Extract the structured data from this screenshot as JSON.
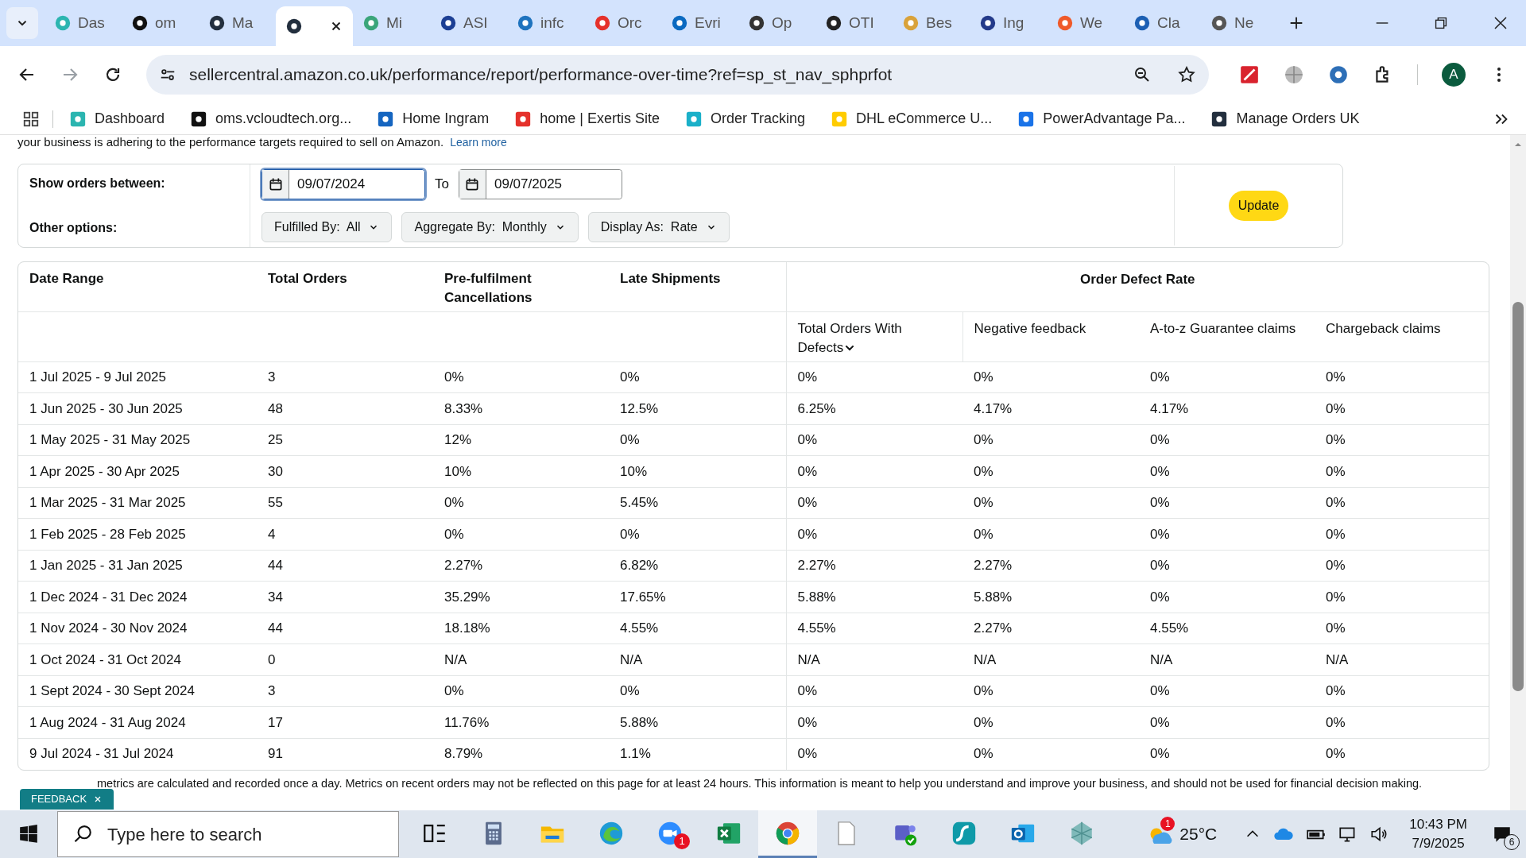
{
  "browser": {
    "tabs": [
      {
        "title": "Das",
        "selected": false
      },
      {
        "title": "om",
        "selected": false
      },
      {
        "title": "Ma",
        "selected": false
      },
      {
        "selected": true
      },
      {
        "title": "Mi",
        "selected": false
      },
      {
        "title": "ASI",
        "selected": false
      },
      {
        "title": "infc",
        "selected": false
      },
      {
        "title": "Orc",
        "selected": false
      },
      {
        "title": "Evri",
        "selected": false
      },
      {
        "title": "Op",
        "selected": false
      },
      {
        "title": "OTI",
        "selected": false
      },
      {
        "title": "Bes",
        "selected": false
      },
      {
        "title": "Ing",
        "selected": false
      },
      {
        "title": "We",
        "selected": false
      },
      {
        "title": "Cla",
        "selected": false
      },
      {
        "title": "Ne",
        "selected": false
      }
    ],
    "address": "sellercentral.amazon.co.uk/performance/report/performance-over-time?ref=sp_st_nav_sphprfot",
    "profile": "A",
    "bookmarks": [
      "Dashboard",
      "oms.vcloudtech.org...",
      "Home Ingram",
      "home | Exertis Site",
      "Order Tracking",
      "DHL eCommerce U...",
      "PowerAdvantage Pa...",
      "Manage Orders UK"
    ]
  },
  "page": {
    "intro": "your business is adhering to the performance targets required to sell on Amazon.",
    "intro_link": "Learn more",
    "filters": {
      "range_label": "Show orders between:",
      "from": "09/07/2024",
      "to_label": "To",
      "to": "09/07/2025",
      "options_label": "Other options:",
      "dropdowns": [
        {
          "label": "Fulfilled By:",
          "value": "All"
        },
        {
          "label": "Aggregate By:",
          "value": "Monthly"
        },
        {
          "label": "Display As:",
          "value": "Rate"
        }
      ],
      "update": "Update"
    },
    "table": {
      "columns": [
        "Date Range",
        "Total Orders",
        "Pre-fulfilment Cancellations",
        "Late Shipments"
      ],
      "group": "Order Defect Rate",
      "subcolumns": [
        {
          "label": "Total Orders With Defects",
          "sortable": true
        },
        {
          "label": "Negative feedback",
          "sortable": false
        },
        {
          "label": "A-to-z Guarantee claims",
          "sortable": false
        },
        {
          "label": "Chargeback claims",
          "sortable": false
        }
      ],
      "rows": [
        [
          "1 Jul 2025 - 9 Jul 2025",
          "3",
          "0%",
          "0%",
          "0%",
          "0%",
          "0%",
          "0%"
        ],
        [
          "1 Jun 2025 - 30 Jun 2025",
          "48",
          "8.33%",
          "12.5%",
          "6.25%",
          "4.17%",
          "4.17%",
          "0%"
        ],
        [
          "1 May 2025 - 31 May 2025",
          "25",
          "12%",
          "0%",
          "0%",
          "0%",
          "0%",
          "0%"
        ],
        [
          "1 Apr 2025 - 30 Apr 2025",
          "30",
          "10%",
          "10%",
          "0%",
          "0%",
          "0%",
          "0%"
        ],
        [
          "1 Mar 2025 - 31 Mar 2025",
          "55",
          "0%",
          "5.45%",
          "0%",
          "0%",
          "0%",
          "0%"
        ],
        [
          "1 Feb 2025 - 28 Feb 2025",
          "4",
          "0%",
          "0%",
          "0%",
          "0%",
          "0%",
          "0%"
        ],
        [
          "1 Jan 2025 - 31 Jan 2025",
          "44",
          "2.27%",
          "6.82%",
          "2.27%",
          "2.27%",
          "0%",
          "0%"
        ],
        [
          "1 Dec 2024 - 31 Dec 2024",
          "34",
          "35.29%",
          "17.65%",
          "5.88%",
          "5.88%",
          "0%",
          "0%"
        ],
        [
          "1 Nov 2024 - 30 Nov 2024",
          "44",
          "18.18%",
          "4.55%",
          "4.55%",
          "2.27%",
          "4.55%",
          "0%"
        ],
        [
          "1 Oct 2024 - 31 Oct 2024",
          "0",
          "N/A",
          "N/A",
          "N/A",
          "N/A",
          "N/A",
          "N/A"
        ],
        [
          "1 Sept 2024 - 30 Sept 2024",
          "3",
          "0%",
          "0%",
          "0%",
          "0%",
          "0%",
          "0%"
        ],
        [
          "1 Aug 2024 - 31 Aug 2024",
          "17",
          "11.76%",
          "5.88%",
          "0%",
          "0%",
          "0%",
          "0%"
        ],
        [
          "9 Jul 2024 - 31 Jul 2024",
          "91",
          "8.79%",
          "1.1%",
          "0%",
          "0%",
          "0%",
          "0%"
        ]
      ]
    },
    "note": "metrics are calculated and recorded once a day. Metrics on recent orders may not be reflected on this page for at least 24 hours. This information is meant to help you understand and improve your business, and should not be used for financial decision making.",
    "feedback": "FEEDBACK"
  },
  "taskbar": {
    "search_placeholder": "Type here to search",
    "apps": [
      {
        "kind": "taskview",
        "selected": false
      },
      {
        "kind": "calculator",
        "selected": false
      },
      {
        "kind": "files",
        "selected": false
      },
      {
        "kind": "edge",
        "selected": false
      },
      {
        "kind": "zoom",
        "badge": "1",
        "selected": false
      },
      {
        "kind": "excel",
        "selected": false
      },
      {
        "kind": "chrome",
        "selected": true
      },
      {
        "kind": "document",
        "selected": false
      },
      {
        "kind": "teams",
        "selected": false
      },
      {
        "kind": "stream",
        "selected": false
      },
      {
        "kind": "outlook",
        "selected": false
      },
      {
        "kind": "gem",
        "selected": false
      }
    ],
    "weather_badge": "1",
    "temperature": "25°C",
    "time": "10:43 PM",
    "date": "7/9/2025",
    "notifications": "6"
  }
}
